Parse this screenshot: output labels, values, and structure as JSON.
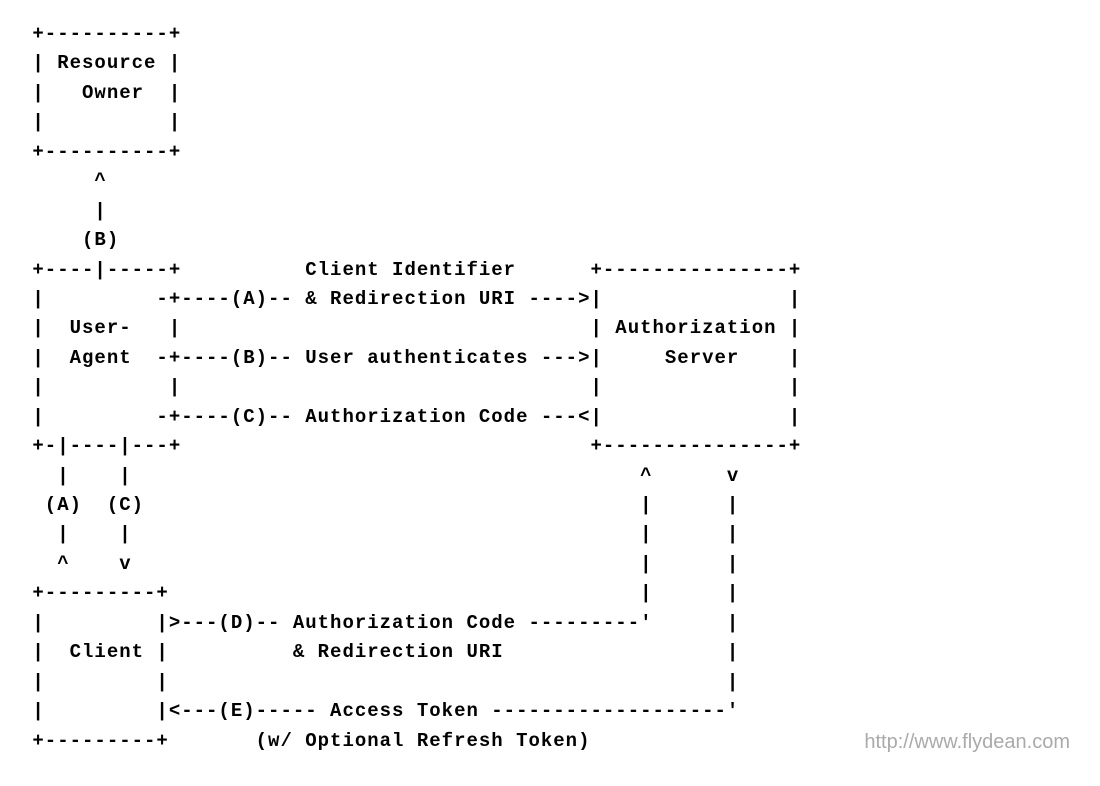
{
  "boxes": {
    "resource_owner": "Resource Owner",
    "user_agent": "User-Agent",
    "authorization_server": "Authorization Server",
    "client": "Client"
  },
  "flows": {
    "A": {
      "label": "(A)",
      "text1": "Client Identifier",
      "text2": "& Redirection URI"
    },
    "B": {
      "label": "(B)",
      "text": "User authenticates"
    },
    "C": {
      "label": "(C)",
      "text": "Authorization Code"
    },
    "D": {
      "label": "(D)",
      "text1": "Authorization Code",
      "text2": "& Redirection URI"
    },
    "E": {
      "label": "(E)",
      "text1": "Access Token",
      "text2": "(w/ Optional Refresh Token)"
    }
  },
  "watermark": "http://www.flydean.com",
  "ascii": {
    "l01": " +----------+",
    "l02": " | Resource |",
    "l03": " |   Owner  |",
    "l04": " |          |",
    "l05": " +----------+",
    "l06": "      ^",
    "l07": "      |",
    "l08": "     (B)",
    "l09": " +----|-----+          Client Identifier      +---------------+",
    "l10": " |         -+----(A)-- & Redirection URI ---->|               |",
    "l11": " |  User-   |                                 | Authorization |",
    "l12": " |  Agent  -+----(B)-- User authenticates --->|     Server    |",
    "l13": " |          |                                 |               |",
    "l14": " |         -+----(C)-- Authorization Code ---<|               |",
    "l15": " +-|----|---+                                 +---------------+",
    "l16": "   |    |                                         ^      v",
    "l17": "  (A)  (C)                                        |      |",
    "l18": "   |    |                                         |      |",
    "l19": "   ^    v                                         |      |",
    "l20": " +---------+                                      |      |",
    "l21": " |         |>---(D)-- Authorization Code ---------'      |",
    "l22": " |  Client |          & Redirection URI                  |",
    "l23": " |         |                                             |",
    "l24": " |         |<---(E)----- Access Token -------------------'",
    "l25": " +---------+       (w/ Optional Refresh Token)"
  }
}
